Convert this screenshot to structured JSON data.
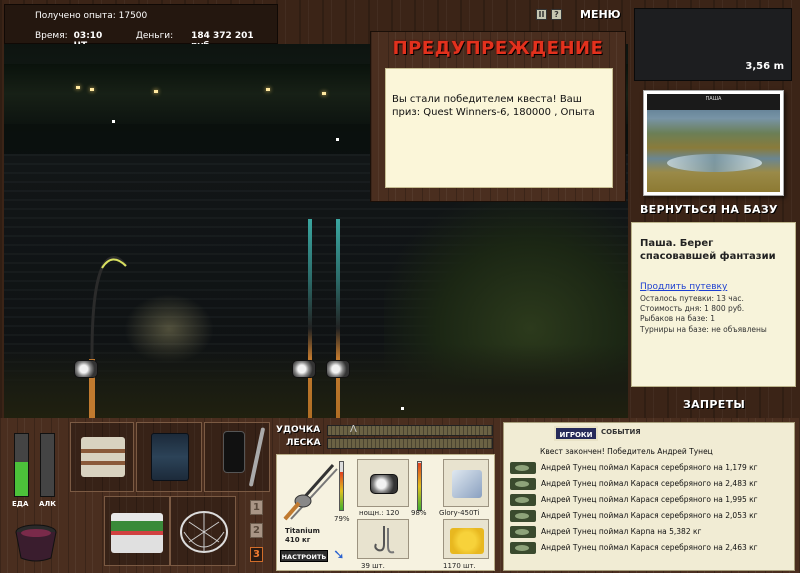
{
  "info": {
    "experience_label": "Получено опыта:",
    "experience_value": "17500",
    "time_label": "Время:",
    "time_value": "03:10 ЧТ",
    "money_label": "Деньги:",
    "money_value": "184 372 201 руб."
  },
  "top": {
    "menu_label": "МЕНЮ",
    "pause_glyph": "II",
    "zoom_glyph": "?",
    "depth_value": "3,56 m"
  },
  "warning": {
    "title": "ПРЕДУПРЕЖДЕНИЕ",
    "message": "Вы стали победителем квеста! Ваш приз: Quest Winners-6, 180000 , Опыта"
  },
  "location": {
    "return_label": "ВЕРНУТЬСЯ НА БАЗУ",
    "photo_caption": "ПАША",
    "base_name": "Паша. Берег спасовавшей фантазии",
    "extend_label": "Продлить путевку",
    "remaining": "Осталось путевки: 13 час.",
    "day_cost": "Стоимость дня: 1 800 руб.",
    "fishers": "Рыбаков на базе: 1",
    "tournaments": "Турниры на базе: не объявлены",
    "bans_label": "ЗАПРЕТЫ"
  },
  "status": {
    "food_label": "ЕДА",
    "alcohol_label": "АЛК",
    "food_level": 0.55,
    "alcohol_level": 0.0,
    "food_color": "#4cc23a"
  },
  "bars": {
    "rod_label": "УДОЧКА",
    "line_label": "ЛЕСКА"
  },
  "rod_buttons": [
    "1",
    "2",
    "3"
  ],
  "active_rod": 2,
  "tackle": {
    "rod_name": "Titanium",
    "rod_weight": "410 кг",
    "rod_condition": "79%",
    "reel_label": "нощн.: 120",
    "reel_condition": "98%",
    "line_name": "Glory-450Ti",
    "hooks_count": "39 шт.",
    "bait_count": "1170 шт.",
    "setup_label": "НАСТРОИТЬ"
  },
  "chat": {
    "tab_players": "ИГРОКИ",
    "tab_events": "СОБЫТИЯ",
    "messages": [
      "Квест закончен! Победитель Андрей Тунец",
      "Андрей Тунец поймал Карася серебряного на 1,179 кг",
      "Андрей Тунец поймал Карася серебряного на 2,483 кг",
      "Андрей Тунец поймал Карася серебряного на 1,995 кг",
      "Андрей Тунец поймал Карася серебряного на 2,053 кг",
      "Андрей Тунец поймал Карпа на 5,382 кг",
      "Андрей Тунец поймал Карася серебряного на 2,463 кг"
    ]
  }
}
